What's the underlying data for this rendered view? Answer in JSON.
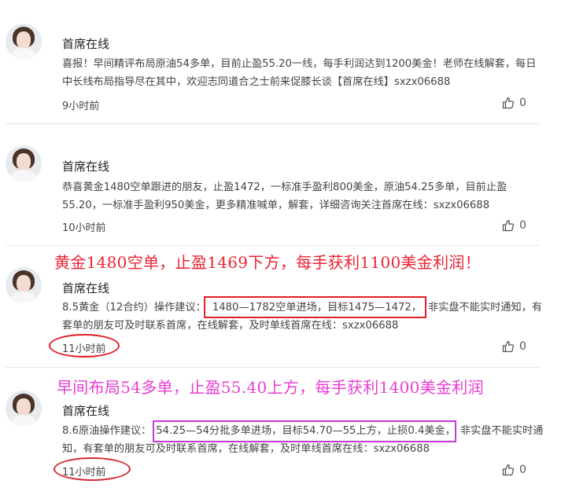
{
  "posts": [
    {
      "author": "首席在线",
      "content": "喜报！早间精评布局原油54多单，目前止盈55.20一线，每手利润达到1200美金！老师在线解套，每日中长线布局指导尽在其中，欢迎志同道合之士前来促膝长谈【首席在线】sxzx06688",
      "time": "9小时前",
      "likes": "0"
    },
    {
      "author": "首席在线",
      "content": "恭喜黄金1480空单跟进的朋友，止盈1472，一标准手盈利800美金，原油54.25多单，目前止盈55.20，一标准手盈利950美金，更多精准喊单，解套，详细咨询关注首席在线：sxzx06688",
      "time": "10小时前",
      "likes": "0"
    },
    {
      "author": "首席在线",
      "content_pre": "8.5黄金（12合约）操作建议：",
      "content_highlight": "1480—1782空单进场，目标1475—1472，",
      "content_post": "非实盘不能实时通知，有套单的朋友可及时联系首席，在线解套，及时单线首席在线：sxzx06688",
      "time": "11小时前",
      "likes": "0"
    },
    {
      "author": "首席在线",
      "content_pre": "8.6原油操作建议：",
      "content_highlight": "54.25—54分批多单进场，目标54.70—55上方，止损0.4美金，",
      "content_post": "非实盘不能实时通知，有套单的朋友可及时联系首席，在线解套，及时单线首席在线：sxzx06688",
      "time": "11小时前",
      "likes": "0"
    }
  ],
  "annotations": {
    "red": "黄金1480空单，止盈1469下方，每手获利1100美金利润！",
    "magenta": "早间布局54多单，止盈55.40上方，每手获利1400美金利润"
  },
  "colors": {
    "annotation_red": "#ec2233",
    "annotation_magenta": "#e83cd0"
  },
  "icons": {
    "like": "thumbs-up-icon"
  }
}
